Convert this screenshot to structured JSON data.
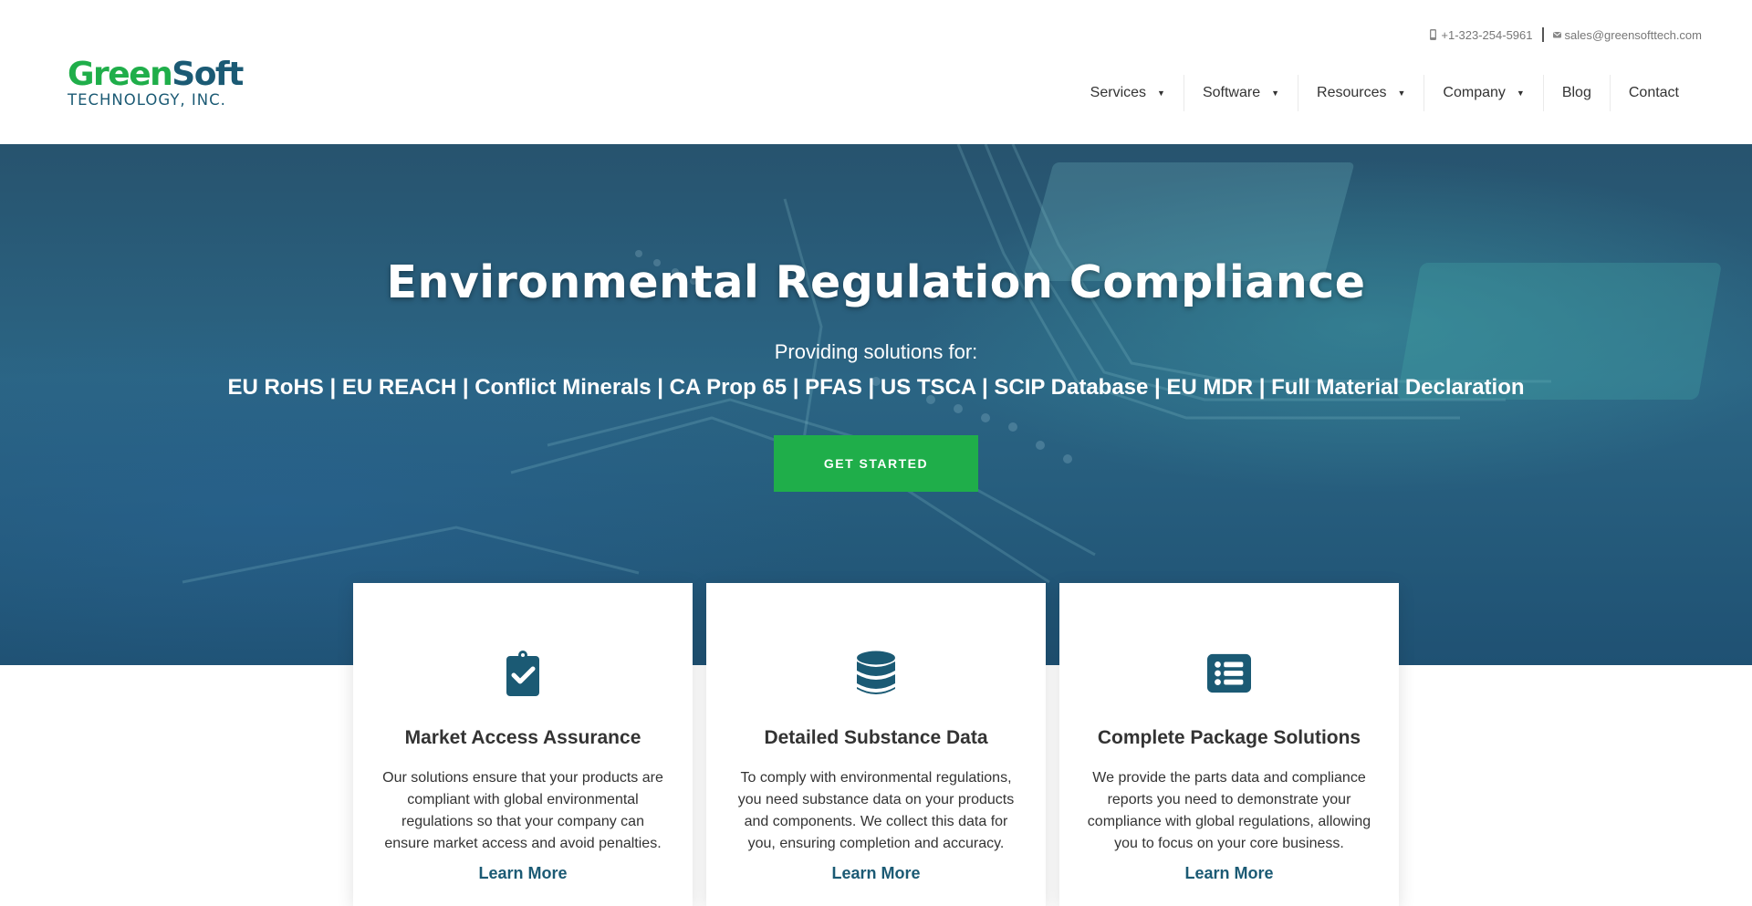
{
  "logo": {
    "green": "Green",
    "blue": "Soft",
    "subtitle": "TECHNOLOGY, INC."
  },
  "topbar": {
    "phone": "+1-323-254-5961",
    "email": "sales@greensofttech.com"
  },
  "nav": {
    "items": [
      {
        "label": "Services",
        "dropdown": true
      },
      {
        "label": "Software",
        "dropdown": true
      },
      {
        "label": "Resources",
        "dropdown": true
      },
      {
        "label": "Company",
        "dropdown": true
      },
      {
        "label": "Blog",
        "dropdown": false
      },
      {
        "label": "Contact",
        "dropdown": false
      }
    ]
  },
  "hero": {
    "title": "Environmental Regulation Compliance",
    "subtitle": "Providing solutions for:",
    "list": "EU RoHS | EU REACH | Conflict Minerals | CA Prop 65 | PFAS | US TSCA | SCIP Database | EU MDR | Full Material Declaration",
    "cta": "GET STARTED"
  },
  "cards": [
    {
      "icon": "clipboard-check-icon",
      "title": "Market Access Assurance",
      "text": "Our solutions ensure that your products are compliant with global environmental regulations so that your company can ensure market access and avoid penalties.",
      "link": "Learn More"
    },
    {
      "icon": "database-icon",
      "title": "Detailed Substance Data",
      "text": "To comply with environmental regulations, you need substance data on your products and components. We collect this data for you, ensuring completion and accuracy.",
      "link": "Learn More"
    },
    {
      "icon": "list-alt-icon",
      "title": "Complete Package Solutions",
      "text": "We provide the parts data and compliance reports you need to demonstrate your compliance with global regulations, allowing you to focus on your core business.",
      "link": "Learn More"
    }
  ],
  "colors": {
    "brand_green": "#1fae4a",
    "brand_blue": "#1b5a74",
    "hero_bg": "#2b6584"
  }
}
